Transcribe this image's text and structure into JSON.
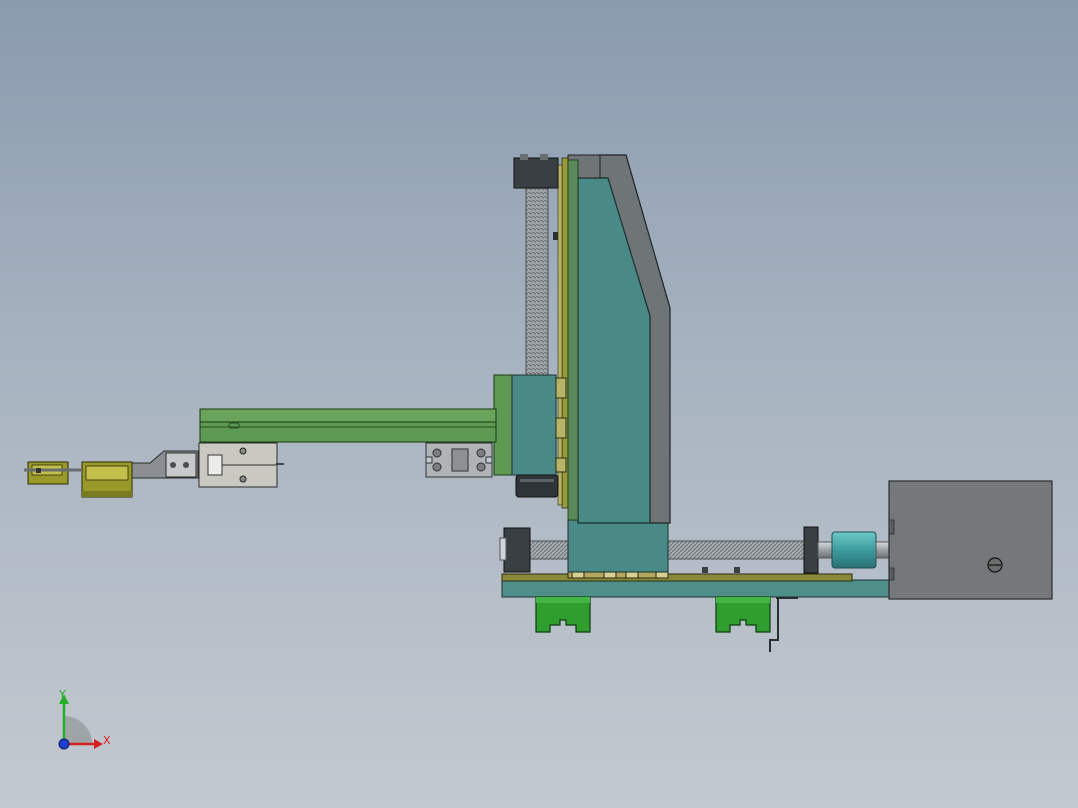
{
  "triad": {
    "x_label": "X",
    "y_label": "Y"
  },
  "colors": {
    "background_top": "#8a9bae",
    "background_bottom": "#c3c9d0",
    "teal_body": "#4a8a86",
    "green_profile": "#5f9a55",
    "dark_motor": "#3a3f44",
    "grey_box": "#757879",
    "green_rail_block": "#2e9a2e",
    "olive_gripper": "#9a9a2a",
    "ballscrew": "#9a9fa3"
  }
}
